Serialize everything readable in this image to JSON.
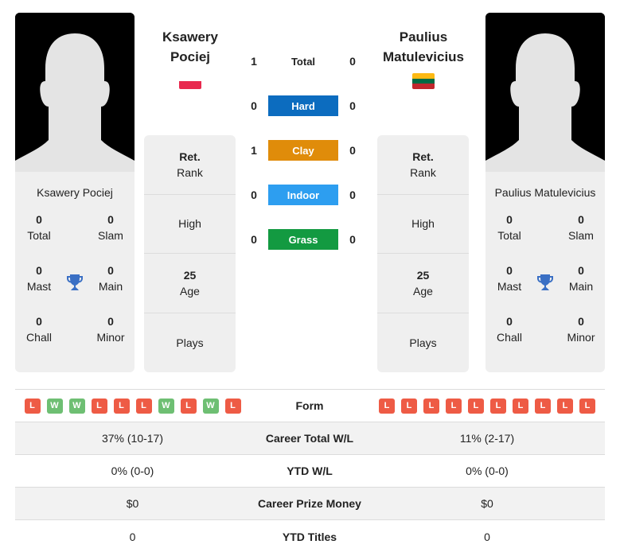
{
  "player1": {
    "name_header": [
      "Ksawery",
      "Pociej"
    ],
    "name": "Ksawery Pociej",
    "flag": "poland-flag",
    "flag_colors": [
      "#ffffff",
      "#e8294e"
    ],
    "titles": {
      "total": {
        "value": "0",
        "label": "Total"
      },
      "slam": {
        "value": "0",
        "label": "Slam"
      },
      "mast": {
        "value": "0",
        "label": "Mast"
      },
      "main": {
        "value": "0",
        "label": "Main"
      },
      "chall": {
        "value": "0",
        "label": "Chall"
      },
      "minor": {
        "value": "0",
        "label": "Minor"
      }
    },
    "info": {
      "rank_value": "Ret.",
      "rank_label": "Rank",
      "high_label": "High",
      "age_value": "25",
      "age_label": "Age",
      "plays_label": "Plays"
    },
    "form": [
      "L",
      "W",
      "W",
      "L",
      "L",
      "L",
      "W",
      "L",
      "W",
      "L"
    ],
    "career_total_wl": "37% (10-17)",
    "ytd_wl": "0% (0-0)",
    "career_prize_money": "$0",
    "ytd_titles": "0"
  },
  "player2": {
    "name_header": [
      "Paulius",
      "Matulevicius"
    ],
    "name": "Paulius Matulevicius",
    "flag": "lithuania-flag",
    "flag_colors": [
      "#fdb913",
      "#006a44",
      "#c1272d"
    ],
    "titles": {
      "total": {
        "value": "0",
        "label": "Total"
      },
      "slam": {
        "value": "0",
        "label": "Slam"
      },
      "mast": {
        "value": "0",
        "label": "Mast"
      },
      "main": {
        "value": "0",
        "label": "Main"
      },
      "chall": {
        "value": "0",
        "label": "Chall"
      },
      "minor": {
        "value": "0",
        "label": "Minor"
      }
    },
    "info": {
      "rank_value": "Ret.",
      "rank_label": "Rank",
      "high_label": "High",
      "age_value": "25",
      "age_label": "Age",
      "plays_label": "Plays"
    },
    "form": [
      "L",
      "L",
      "L",
      "L",
      "L",
      "L",
      "L",
      "L",
      "L",
      "L"
    ],
    "career_total_wl": "11% (2-17)",
    "ytd_wl": "0% (0-0)",
    "career_prize_money": "$0",
    "ytd_titles": "0"
  },
  "h2h": [
    {
      "label": "Total",
      "p1": "1",
      "p2": "0",
      "color": null
    },
    {
      "label": "Hard",
      "p1": "0",
      "p2": "0",
      "color": "#0c6cbf"
    },
    {
      "label": "Clay",
      "p1": "1",
      "p2": "0",
      "color": "#e08c0a"
    },
    {
      "label": "Indoor",
      "p1": "0",
      "p2": "0",
      "color": "#2d9ef0"
    },
    {
      "label": "Grass",
      "p1": "0",
      "p2": "0",
      "color": "#139a41"
    }
  ],
  "table_labels": {
    "form": "Form",
    "career_total_wl": "Career Total W/L",
    "ytd_wl": "YTD W/L",
    "career_prize_money": "Career Prize Money",
    "ytd_titles": "YTD Titles"
  },
  "colors": {
    "loss": "#ee5b45",
    "win": "#6ebf73",
    "trophy": "#3a6fc4"
  }
}
